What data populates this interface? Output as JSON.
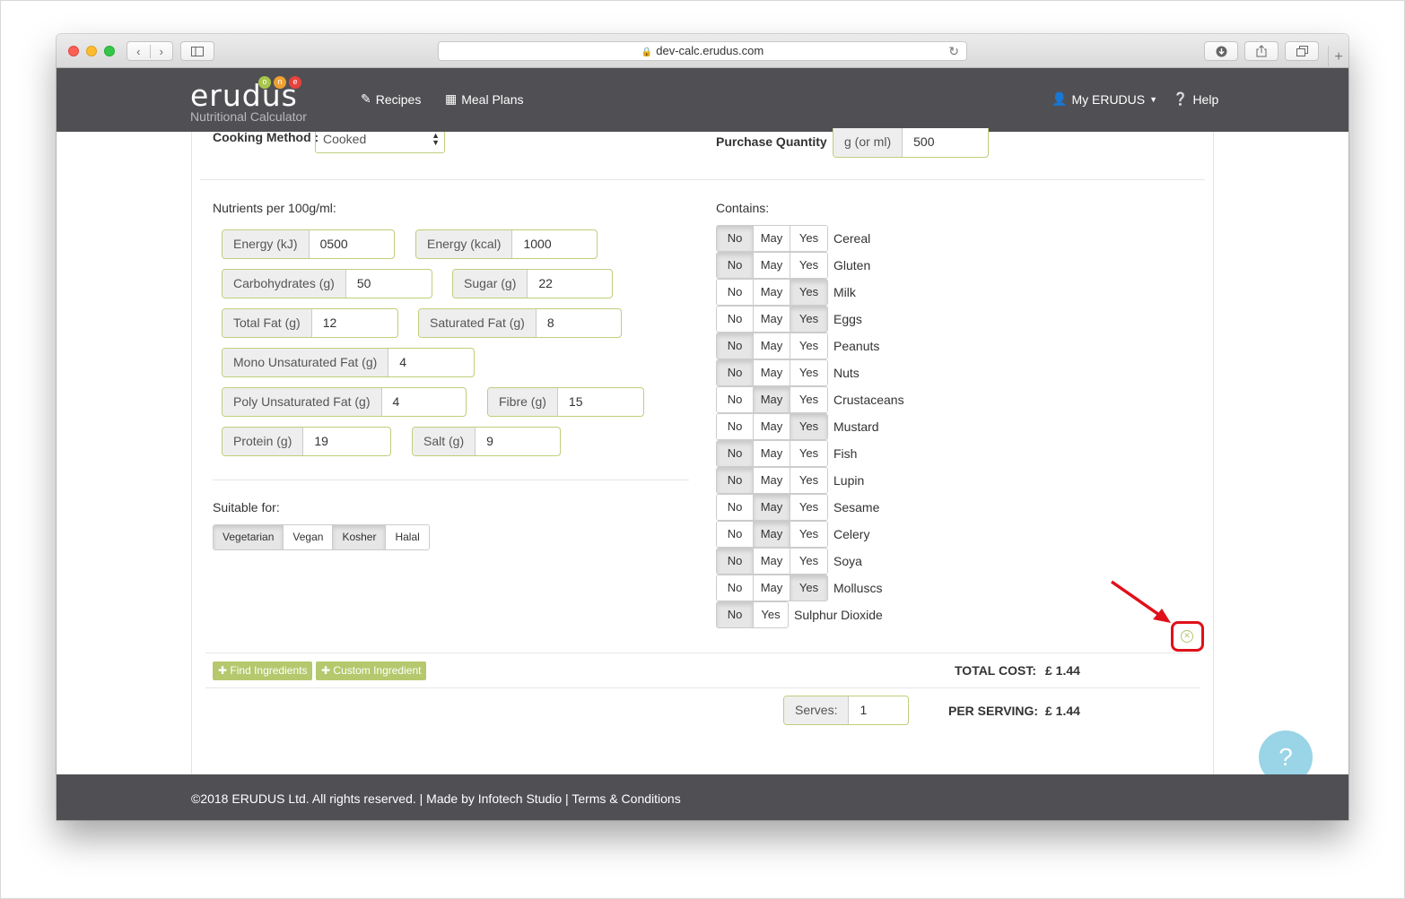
{
  "browser": {
    "url": "dev-calc.erudus.com",
    "back_glyph": "‹",
    "forward_glyph": "›",
    "reload_glyph": "↻",
    "newtab_glyph": "+"
  },
  "header": {
    "logo_text": "erudus",
    "logo_dots": [
      {
        "letter": "o",
        "color": "#a7c64a"
      },
      {
        "letter": "n",
        "color": "#f0a030"
      },
      {
        "letter": "e",
        "color": "#e8413c"
      }
    ],
    "logo_subtitle": "Nutritional Calculator",
    "nav": {
      "recipes": "Recipes",
      "meal_plans": "Meal Plans",
      "my_erudus": "My ERUDUS",
      "help": "Help"
    }
  },
  "form": {
    "cooking_method_label": "Cooking Method :",
    "cooking_method_value": "Cooked",
    "purchase_quantity_label": "Purchase Quantity",
    "purchase_unit": "g (or ml)",
    "purchase_value": "500"
  },
  "nutrients": {
    "heading": "Nutrients per 100g/ml:",
    "energy_kj": {
      "label": "Energy (kJ)",
      "value": "0500"
    },
    "energy_kcal": {
      "label": "Energy (kcal)",
      "value": "1000"
    },
    "carbs": {
      "label": "Carbohydrates (g)",
      "value": "50"
    },
    "sugar": {
      "label": "Sugar (g)",
      "value": "22"
    },
    "total_fat": {
      "label": "Total Fat (g)",
      "value": "12"
    },
    "sat_fat": {
      "label": "Saturated Fat (g)",
      "value": "8"
    },
    "mono_fat": {
      "label": "Mono Unsaturated Fat (g)",
      "value": "4"
    },
    "poly_fat": {
      "label": "Poly Unsaturated Fat (g)",
      "value": "4"
    },
    "fibre": {
      "label": "Fibre (g)",
      "value": "15"
    },
    "protein": {
      "label": "Protein (g)",
      "value": "19"
    },
    "salt": {
      "label": "Salt (g)",
      "value": "9"
    }
  },
  "suitable": {
    "heading": "Suitable for:",
    "options": [
      {
        "label": "Vegetarian",
        "active": true
      },
      {
        "label": "Vegan",
        "active": false
      },
      {
        "label": "Kosher",
        "active": true
      },
      {
        "label": "Halal",
        "active": false
      }
    ]
  },
  "contains": {
    "heading": "Contains:",
    "labels": {
      "no": "No",
      "may": "May",
      "yes": "Yes"
    },
    "items": [
      {
        "name": "Cereal",
        "selected": "no"
      },
      {
        "name": "Gluten",
        "selected": "no"
      },
      {
        "name": "Milk",
        "selected": "yes"
      },
      {
        "name": "Eggs",
        "selected": "yes"
      },
      {
        "name": "Peanuts",
        "selected": "no"
      },
      {
        "name": "Nuts",
        "selected": "no"
      },
      {
        "name": "Crustaceans",
        "selected": "may"
      },
      {
        "name": "Mustard",
        "selected": "yes"
      },
      {
        "name": "Fish",
        "selected": "no"
      },
      {
        "name": "Lupin",
        "selected": "no"
      },
      {
        "name": "Sesame",
        "selected": "may"
      },
      {
        "name": "Celery",
        "selected": "may"
      },
      {
        "name": "Soya",
        "selected": "no"
      },
      {
        "name": "Molluscs",
        "selected": "yes"
      }
    ],
    "sulphur": {
      "name": "Sulphur Dioxide",
      "selected": "no"
    }
  },
  "actions": {
    "find_ingredients": "Find Ingredients",
    "custom_ingredient": "Custom Ingredient"
  },
  "totals": {
    "total_cost_label": "TOTAL COST:",
    "total_cost_value": "£ 1.44",
    "serves_label": "Serves:",
    "serves_value": "1",
    "per_serving_label": "PER SERVING:",
    "per_serving_value": "£ 1.44"
  },
  "help_bubble": "?",
  "footer": {
    "text": "©2018 ERUDUS Ltd. All rights reserved. | Made by Infotech Studio | Terms & Conditions"
  },
  "colors": {
    "header_bg": "#505054",
    "accent_green": "#b5c86d",
    "annotation_red": "#e0101a",
    "help_blue": "#8fd0e5"
  }
}
